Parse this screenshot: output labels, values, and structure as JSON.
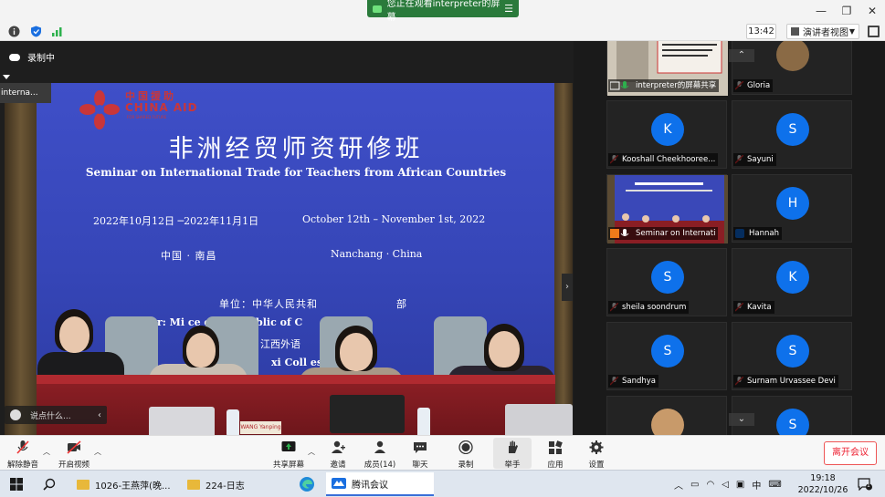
{
  "share_banner": {
    "text": "您正在观看interpreter的屏幕",
    "menu_icon": "menu-icon"
  },
  "infobar": {
    "time": "13:42",
    "view_mode": "演讲者视图"
  },
  "main": {
    "recording": "录制中",
    "name_tag": "interna..."
  },
  "video": {
    "logo_cn": "中国援助",
    "logo_en": "CHINA AID",
    "logo_sub": "FOR SHARED FUTURE",
    "title_cn": "非洲经贸师资研修班",
    "title_en": "Seminar on International Trade for Teachers from African Countries",
    "dates_cn": "2022年10月12日 ─2022年11月1日",
    "dates_en": "October 12th – November 1st, 2022",
    "place_cn": "中国 · 南昌",
    "place_en": "Nanchang · China",
    "org_line1": "单位：中华人民共和",
    "org_line1b": "部",
    "org_line2": "r: Mi        ce of t     Republic of C",
    "org_line3": "江西外语",
    "org_line4": "xi Coll        es",
    "nameplate": "WANG Yanping"
  },
  "chat_overlay": {
    "placeholder": "说点什么..."
  },
  "gallery": {
    "tiles": [
      {
        "name": "interpreter的屏幕共享",
        "type": "screen"
      },
      {
        "name": "Gloria",
        "type": "photo"
      },
      {
        "name": "Kooshall Cheekhooree...",
        "initial": "K"
      },
      {
        "name": "Sayuni",
        "initial": "S"
      },
      {
        "name": "Seminar on Internati",
        "type": "video"
      },
      {
        "name": "Hannah",
        "initial": "H"
      },
      {
        "name": "sheila soondrum",
        "initial": "S"
      },
      {
        "name": "Kavita",
        "initial": "K"
      },
      {
        "name": "Sandhya",
        "initial": "S"
      },
      {
        "name": "Surnam Urvassee Devi",
        "initial": "S"
      },
      {
        "name": "",
        "type": "photo2"
      },
      {
        "name": "",
        "initial": "S"
      }
    ]
  },
  "toolbar": {
    "unmute": "解除静音",
    "video": "开启视频",
    "share": "共享屏幕",
    "invite": "邀请",
    "members": "成员(14)",
    "chat": "聊天",
    "record": "录制",
    "raise_hand": "举手",
    "apps": "应用",
    "settings": "设置",
    "leave": "离开会议"
  },
  "taskbar": {
    "task1": "1026-王燕萍(晚...",
    "task2": "224-日志",
    "task3": "腾讯会议",
    "ime": "中",
    "time": "19:18",
    "date": "2022/10/26",
    "notify_count": "1"
  },
  "colors": {
    "accent": "#0e71eb",
    "banner_blue": "#3646b8",
    "leave_red": "#e23333",
    "share_green": "#2a7a3b"
  }
}
